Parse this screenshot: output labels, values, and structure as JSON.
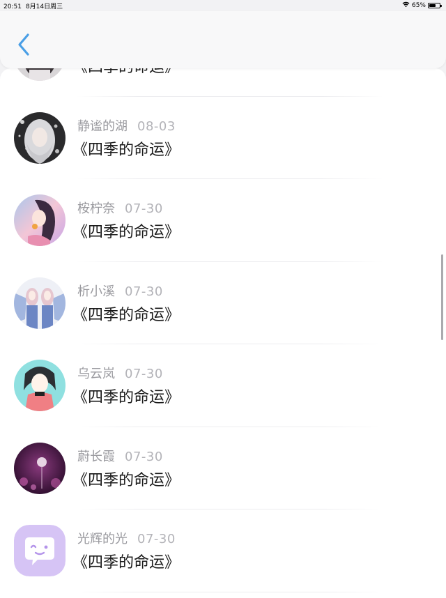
{
  "status_bar": {
    "time": "20:51",
    "date": "8月14日周三",
    "battery_text": "65%",
    "battery_level": 0.65
  },
  "nav": {
    "back_icon": "chevron-left-icon",
    "accent_color": "#4a9fe6"
  },
  "list": {
    "items": [
      {
        "user": "",
        "date": "",
        "work": "《四季的命运》",
        "avatar": "dark-girl-avatar"
      },
      {
        "user": "静谧的湖",
        "date": "08-03",
        "work": "《四季的命运》",
        "avatar": "silver-hair-girl-avatar"
      },
      {
        "user": "桉柠奈",
        "date": "07-30",
        "work": "《四季的命运》",
        "avatar": "pink-illustration-girl-avatar"
      },
      {
        "user": "析小溪",
        "date": "07-30",
        "work": "《四季的命运》",
        "avatar": "two-girls-avatar"
      },
      {
        "user": "乌云岚",
        "date": "07-30",
        "work": "《四季的命运》",
        "avatar": "cyan-anime-girl-avatar"
      },
      {
        "user": "蔚长霞",
        "date": "07-30",
        "work": "《四季的命运》",
        "avatar": "purple-dandelion-avatar"
      },
      {
        "user": "光辉的光",
        "date": "07-30",
        "work": "《四季的命运》",
        "avatar": "default-chat-bubble-avatar"
      }
    ]
  }
}
